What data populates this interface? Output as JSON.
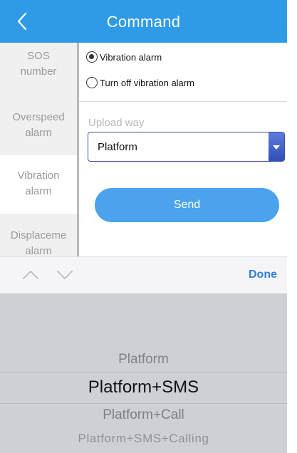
{
  "header": {
    "title": "Command"
  },
  "sidebar": {
    "items": [
      {
        "label": "SOS\nnumber"
      },
      {
        "label": "Overspeed\nalarm"
      },
      {
        "label": "Vibration\nalarm"
      },
      {
        "label": "Displaceme\nalarm"
      }
    ],
    "active_index": 2
  },
  "form": {
    "options": [
      {
        "label": "Vibration alarm",
        "checked": true
      },
      {
        "label": "Turn off vibration alarm",
        "checked": false
      }
    ],
    "upload_label": "Upload way",
    "upload_value": "Platform",
    "send_label": "Send"
  },
  "picker_toolbar": {
    "done_label": "Done"
  },
  "picker": {
    "options": [
      "Platform",
      "Platform+SMS",
      "Platform+Call",
      "Platform+SMS+Calling"
    ],
    "selected_index": 1
  },
  "colors": {
    "header": "#2f9be6",
    "send_button": "#4aa3ec",
    "done_text": "#2f7fd8",
    "picker_bg": "#cdd1d6",
    "select_border": "#3a4fa0"
  },
  "icons": {
    "back": "chevron-left-icon",
    "prev": "chevron-up-icon",
    "next": "chevron-down-icon",
    "dropdown": "triangle-down-icon"
  }
}
